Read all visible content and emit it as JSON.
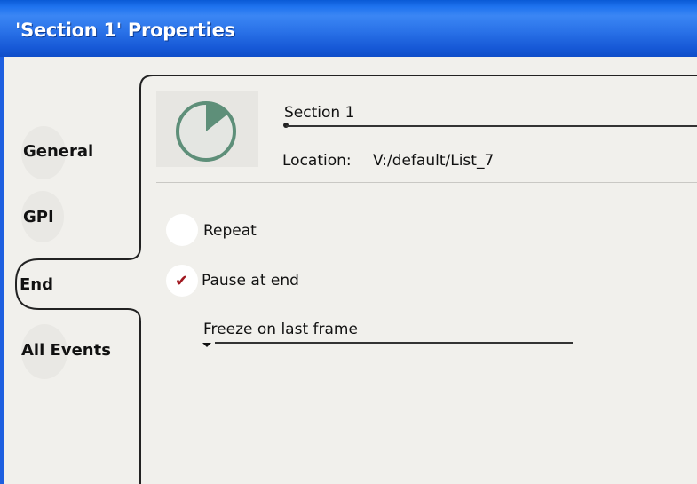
{
  "window": {
    "title": "'Section 1' Properties"
  },
  "tabs": [
    {
      "label": "General",
      "selected": false
    },
    {
      "label": "GPI",
      "selected": false
    },
    {
      "label": "End",
      "selected": true
    },
    {
      "label": "All Events",
      "selected": false
    }
  ],
  "header": {
    "name_value": "Section 1",
    "location_label": "Location:",
    "location_value": "V:/default/List_7"
  },
  "end_options": {
    "repeat_label": "Repeat",
    "repeat_checked": false,
    "pause_label": "Pause at end",
    "pause_checked": true,
    "freeze_value": "Freeze on last frame"
  },
  "colors": {
    "titlebar": "#1f6fe8",
    "panel": "#f1f0ec",
    "check": "#a01820"
  }
}
